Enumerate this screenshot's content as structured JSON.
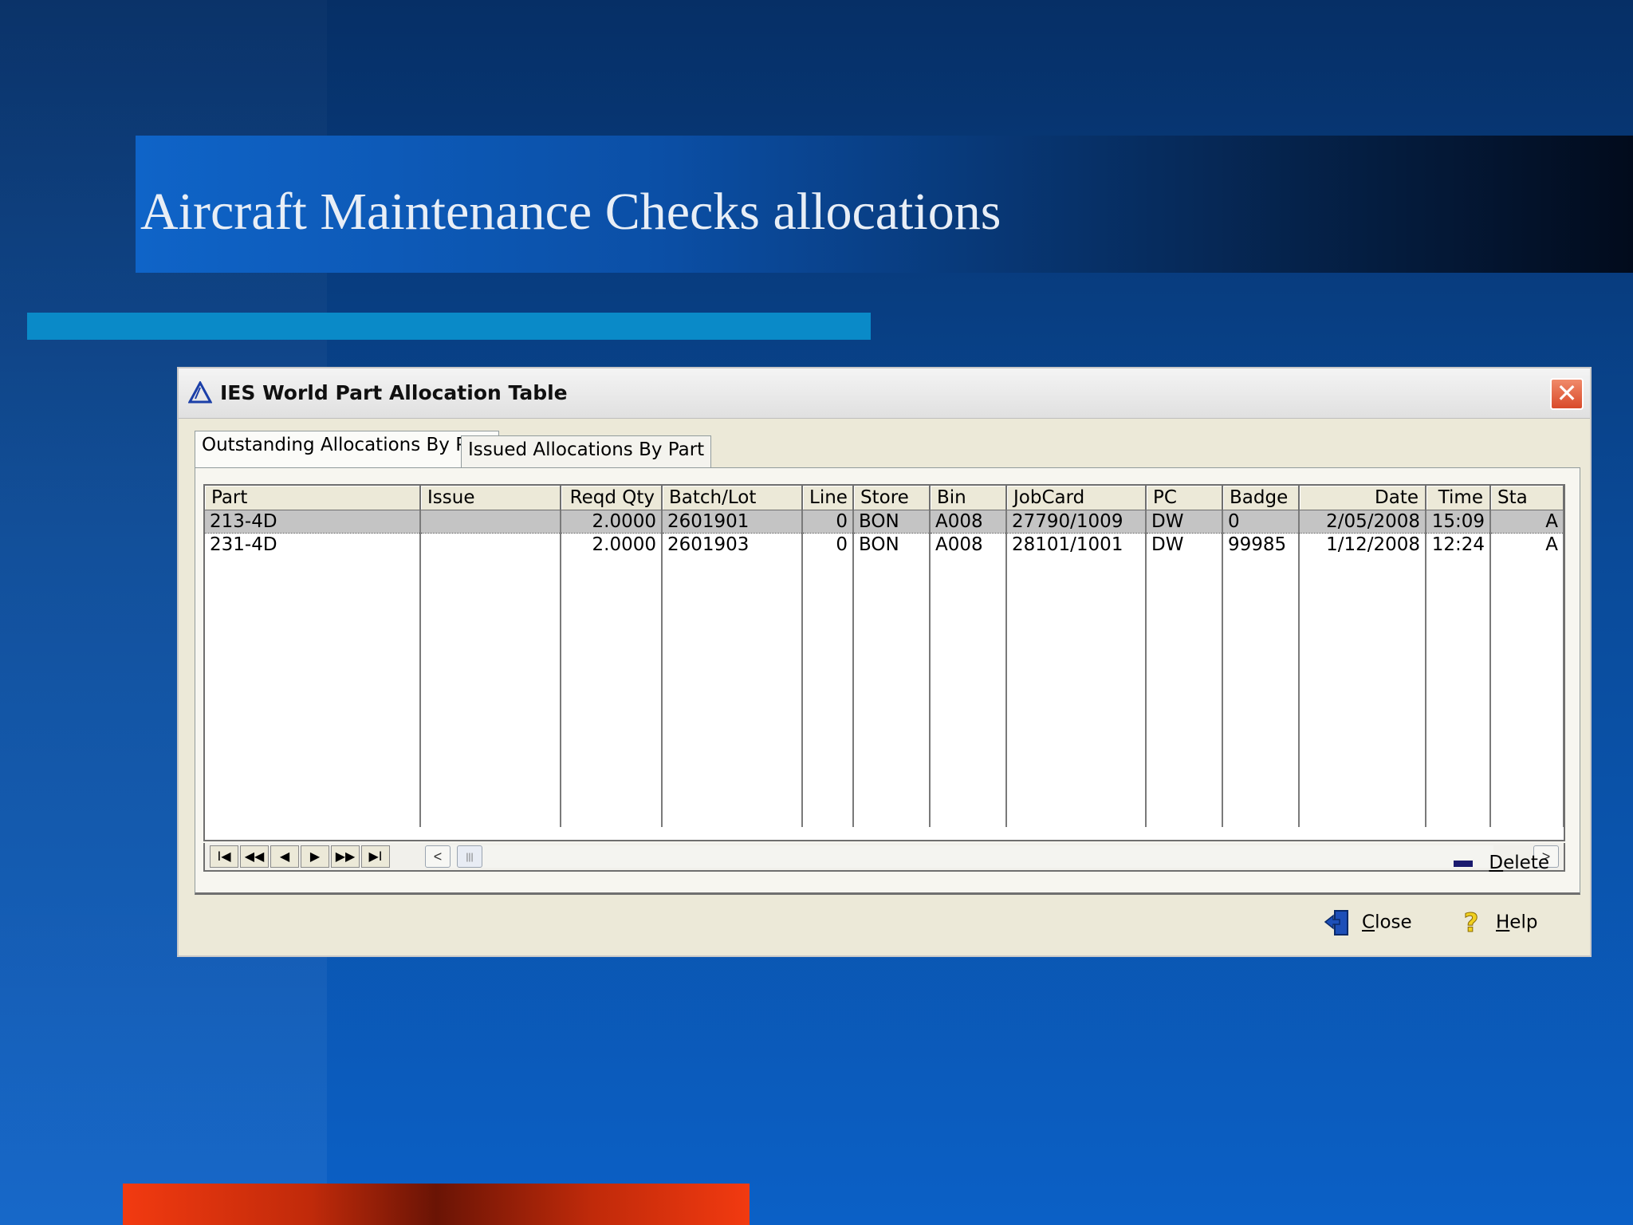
{
  "slide": {
    "title": "Aircraft Maintenance Checks allocations"
  },
  "window": {
    "title": "IES World Part Allocation Table",
    "close_glyph": "✕"
  },
  "tabs": [
    {
      "label": "Outstanding Allocations By Part",
      "active": true
    },
    {
      "label": "Issued Allocations By Part",
      "active": false
    }
  ],
  "grid": {
    "columns": [
      "Part",
      "Issue",
      "Reqd Qty",
      "Batch/Lot",
      "Line",
      "Store",
      "Bin",
      "JobCard",
      "PC",
      "Badge",
      "Date",
      "Time",
      "Sta"
    ],
    "rows": [
      {
        "part": "213-4D",
        "issue": "",
        "reqd_qty": "2.0000",
        "batch_lot": "2601901",
        "line": "0",
        "store": "BON",
        "bin": "A008",
        "jobcard": "27790/1009",
        "pc": "DW",
        "badge": "0",
        "date": "2/05/2008",
        "time": "15:09",
        "sta": "A",
        "selected": true
      },
      {
        "part": "231-4D",
        "issue": "",
        "reqd_qty": "2.0000",
        "batch_lot": "2601903",
        "line": "0",
        "store": "BON",
        "bin": "A008",
        "jobcard": "28101/1001",
        "pc": "DW",
        "badge": "99985",
        "date": "1/12/2008",
        "time": "12:24",
        "sta": "A",
        "selected": false
      }
    ]
  },
  "nav": {
    "first": "I◀",
    "prev_page": "◀◀",
    "prev": "◀",
    "next": "▶",
    "next_page": "▶▶",
    "last": "▶I",
    "scroll_left": "<",
    "scroll_right": ">",
    "thumb": "|||"
  },
  "actions": {
    "delete_label_first": "D",
    "delete_label_rest": "elete",
    "close_label_first": "C",
    "close_label_rest": "lose",
    "help_label_first": "H",
    "help_label_rest": "elp"
  },
  "colors": {
    "background": "#0a4a98",
    "title_bar_start": "#0f64c8",
    "cyan_accent": "#0a8ac8",
    "red_accent": "#f23a10",
    "window_face": "#ece9d8",
    "selected_row": "#c4c4c4"
  }
}
